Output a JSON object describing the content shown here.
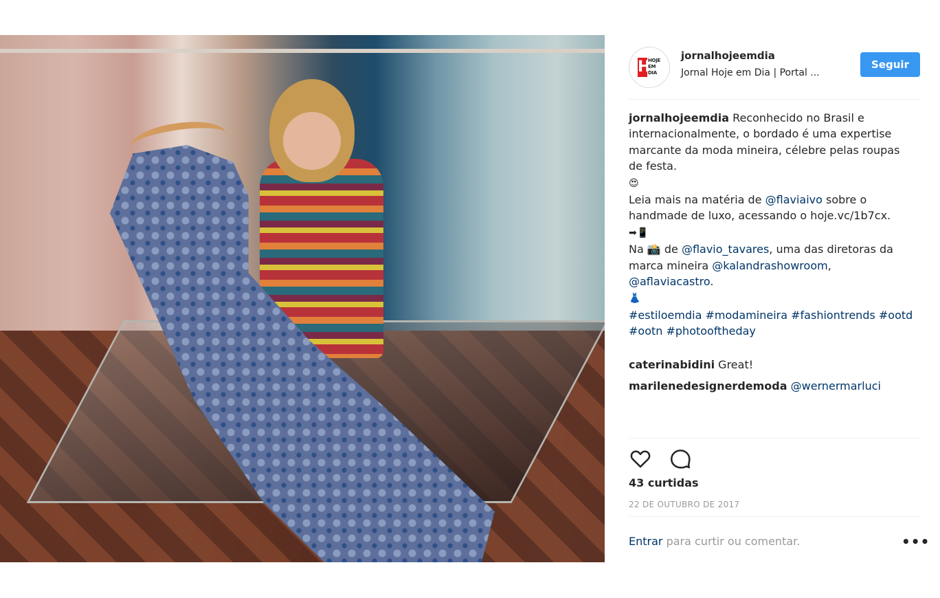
{
  "post": {
    "username": "jornalhojeemdia",
    "location": "Jornal Hoje em Dia | Portal ...",
    "follow_label": "Seguir",
    "avatar_logo_letter": "H",
    "avatar_logo_text": "HOJE EM DIA"
  },
  "caption": {
    "username": "jornalhojeemdia",
    "line1": " Reconhecido no Brasil e internacionalmente, o bordado é uma expertise marcante da moda mineira, célebre pelas roupas de festa.",
    "emoji1": "😍",
    "line2_pre": "Leia mais na matéria de ",
    "mention1": "@flaviaivo",
    "line2_post": " sobre o handmade de luxo, acessando o hoje.vc/1b7cx.",
    "emoji2": "➡📱",
    "line3_pre": "Na 📸 de ",
    "mention2": "@flavio_tavares",
    "line3_mid": ", uma das diretoras da marca mineira ",
    "mention3": "@kalandrashowroom",
    "line3_sep": ", ",
    "mention4": "@aflaviacastro",
    "line3_post": ".",
    "emoji3": "👗",
    "hashtags": "#estiloemdia #modamineira #fashiontrends #ootd #ootn #photooftheday"
  },
  "comments": [
    {
      "user": "caterinabidini",
      "text": " Great!"
    },
    {
      "user": "marilenedesignerdemoda",
      "text": " ",
      "mention": "@wernermarluci"
    }
  ],
  "actions": {
    "like_icon": "heart-icon",
    "comment_icon": "speech-bubble-icon"
  },
  "likes": "43 curtidas",
  "date": "22 DE OUTUBRO DE 2017",
  "login": {
    "link": "Entrar",
    "rest": " para curtir ou comentar."
  },
  "more": "•••",
  "colors": {
    "follow_bg": "#3897f0",
    "link": "#003569",
    "muted": "#999999",
    "divider": "#efefef"
  }
}
